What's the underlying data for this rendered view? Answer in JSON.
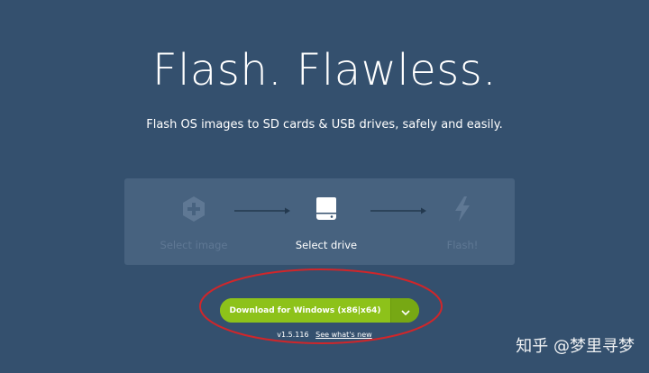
{
  "hero": {
    "title": "Flash. Flawless.",
    "subtitle": "Flash OS images to SD cards & USB drives, safely and easily."
  },
  "steps": [
    {
      "label": "Select image",
      "icon": "plus-hexagon-icon",
      "state": "dim"
    },
    {
      "label": "Select drive",
      "icon": "drive-icon",
      "state": "active"
    },
    {
      "label": "Flash!",
      "icon": "lightning-bolt-icon",
      "state": "dim"
    }
  ],
  "download": {
    "label": "Download for Windows (x86|x64)",
    "dropdown_icon": "chevron-down-icon"
  },
  "version": {
    "number": "v1.5.116",
    "whats_new": "See what's new"
  },
  "watermark": {
    "text": "知乎 @梦里寻梦"
  },
  "colors": {
    "background": "#34506e",
    "panel": "#47627f",
    "button_green": "#8dc21a",
    "dropdown_green": "#77a814",
    "annotation_red": "#d0262a"
  }
}
